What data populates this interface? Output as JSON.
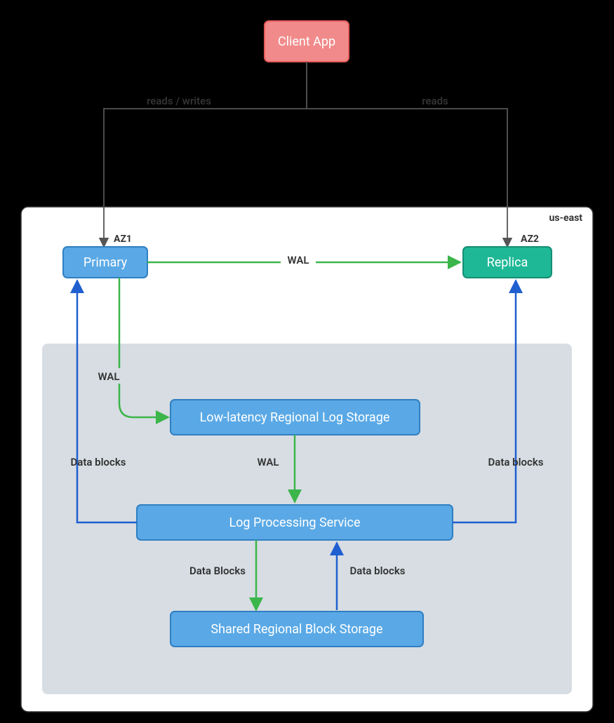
{
  "nodes": {
    "client": {
      "label": "Client App"
    },
    "primary": {
      "label": "Primary",
      "az": "AZ1"
    },
    "replica": {
      "label": "Replica",
      "az": "AZ2"
    },
    "logstore": {
      "label": "Low-latency Regional Log Storage"
    },
    "logsvc": {
      "label": "Log Processing Service"
    },
    "blockstore": {
      "label": "Shared Regional Block Storage"
    }
  },
  "region": {
    "label": "us-east"
  },
  "edges": {
    "client_primary": {
      "label": "reads / writes"
    },
    "client_replica": {
      "label": "reads"
    },
    "primary_replica": {
      "label": "WAL"
    },
    "primary_logstore": {
      "label": "WAL"
    },
    "logstore_logsvc": {
      "label": "WAL"
    },
    "logsvc_block_down": {
      "label": "Data Blocks"
    },
    "block_logsvc_up": {
      "label": "Data blocks"
    },
    "logsvc_primary": {
      "label": "Data blocks"
    },
    "logsvc_replica": {
      "label": "Data blocks"
    }
  },
  "colors": {
    "client_fill": "#f18a8a",
    "client_stroke": "#e85b5b",
    "blue_fill": "#5aa9e6",
    "blue_stroke": "#2f7fc2",
    "teal_fill": "#1fb896",
    "teal_stroke": "#158e74",
    "grey_panel": "#d7dde3",
    "green": "#3cb54a",
    "deepblue": "#1f5fd0",
    "darkgrey": "#555"
  }
}
